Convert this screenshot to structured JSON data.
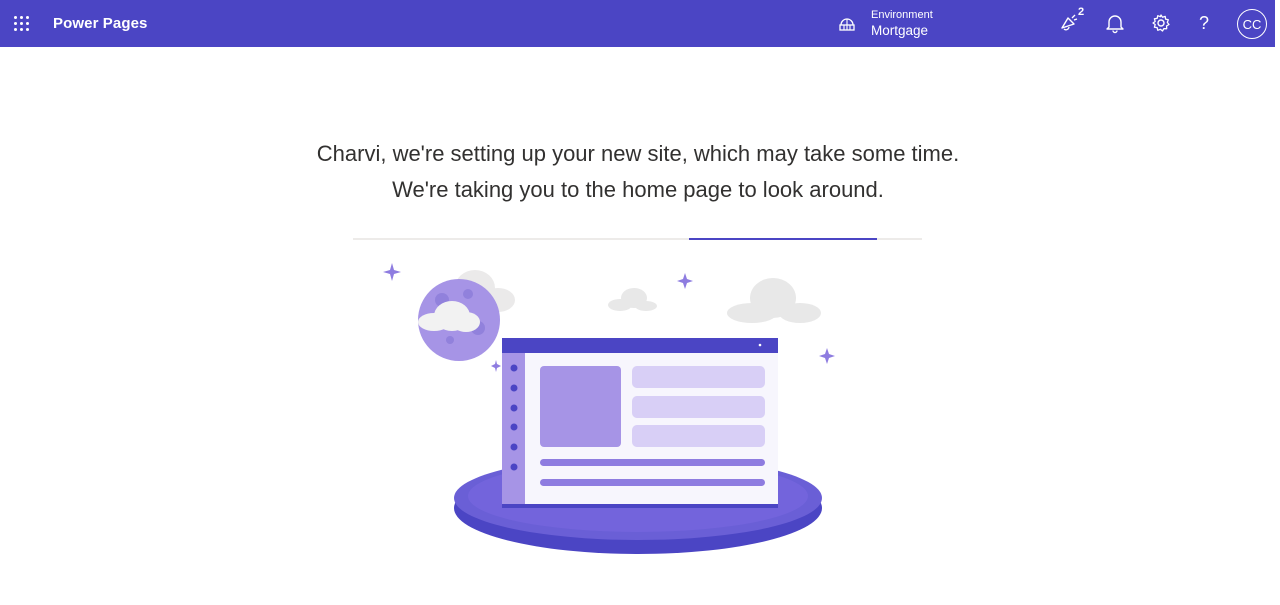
{
  "header": {
    "app_name": "Power Pages",
    "environment_label": "Environment",
    "environment_value": "Mortgage",
    "notification_badge": "2",
    "help_symbol": "?",
    "avatar_initials": "CC"
  },
  "icons": [
    "app-launcher-icon",
    "environment-icon",
    "whats-new-icon",
    "notification-bell-icon",
    "settings-gear-icon",
    "help-icon"
  ],
  "colors": {
    "brand": "#4b45c4",
    "accent_light": "#a694e6",
    "panel_light": "#d8cff6"
  },
  "main": {
    "message_line1": "Charvi, we're setting up your new site, which may take some time.",
    "message_line2": "We're taking you to the home page to look around."
  }
}
